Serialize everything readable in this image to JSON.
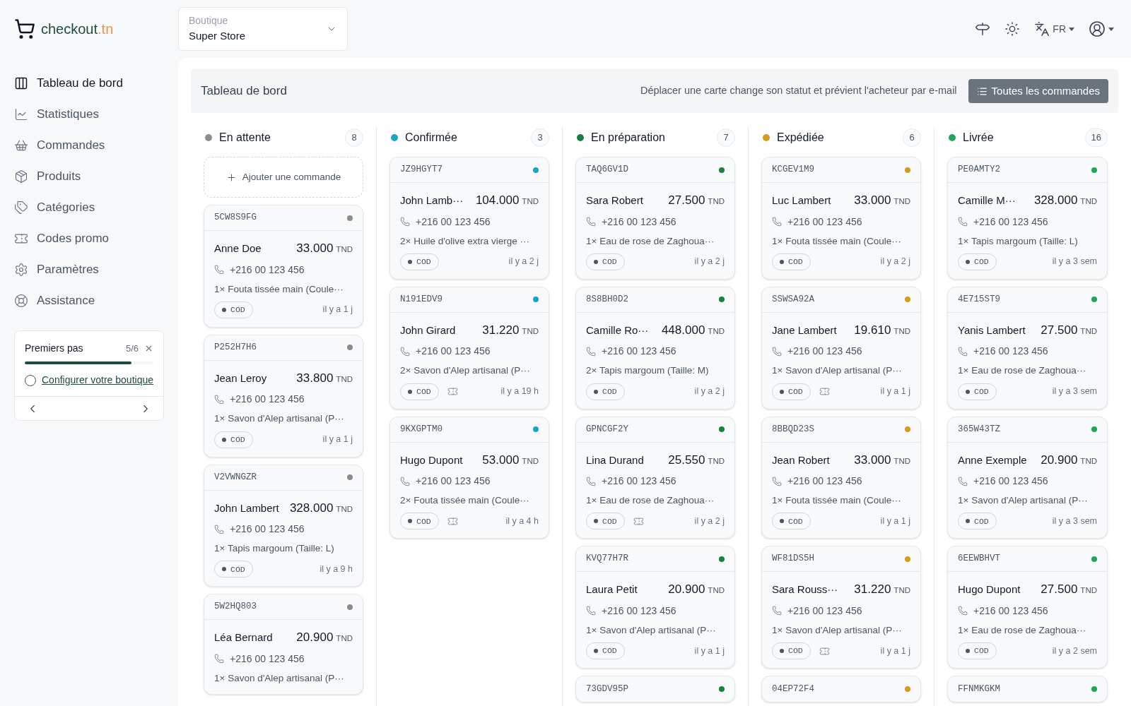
{
  "brand": {
    "name": "checkout",
    "suffix": ".tn"
  },
  "store_selector": {
    "label": "Boutique",
    "value": "Super Store"
  },
  "header": {
    "language": "FR"
  },
  "sidebar": {
    "items": [
      {
        "label": "Tableau de bord",
        "selected": true
      },
      {
        "label": "Statistiques",
        "selected": false
      },
      {
        "label": "Commandes",
        "selected": false
      },
      {
        "label": "Produits",
        "selected": false
      },
      {
        "label": "Catégories",
        "selected": false
      },
      {
        "label": "Codes promo",
        "selected": false
      },
      {
        "label": "Paramètres",
        "selected": false
      },
      {
        "label": "Assistance",
        "selected": false
      }
    ]
  },
  "getting_started": {
    "title": "Premiers pas",
    "progress": "5/6",
    "level": 0.83,
    "task": {
      "label": "Configurer votre boutique",
      "checked": false
    }
  },
  "page": {
    "title": "Tableau de bord",
    "hint": "Déplacer une carte change son statut et prévient l'acheteur par e-mail",
    "button": "Toutes les commandes"
  },
  "columns": [
    {
      "title": "En attente",
      "count": "8",
      "color": "#8c8c8c",
      "add_button": "Ajouter une commande",
      "cards": [
        {
          "id": "5CW8S9FG",
          "name": "Anne Doe",
          "amount": "33.000",
          "currency": "TND",
          "phone": "+216 00 123 456",
          "items": "1× Fouta tissée main (Coule···",
          "payment": "COD",
          "coupon": false,
          "time": "il y a 1 j"
        },
        {
          "id": "P252H7H6",
          "name": "Jean Leroy",
          "amount": "33.800",
          "currency": "TND",
          "phone": "+216 00 123 456",
          "items": "1× Savon d'Alep artisanal (P···",
          "payment": "COD",
          "coupon": false,
          "time": "il y a 1 j"
        },
        {
          "id": "V2VWNGZR",
          "name": "John Lambert",
          "amount": "328.000",
          "currency": "TND",
          "phone": "+216 00 123 456",
          "items": "1× Tapis margoum (Taille: L)",
          "payment": "COD",
          "coupon": false,
          "time": "il y a 9 h"
        },
        {
          "id": "5W2HQ803",
          "name": "Léa Bernard",
          "amount": "20.900",
          "currency": "TND",
          "phone": "+216 00 123 456",
          "items": "1× Savon d'Alep artisanal (P···"
        }
      ]
    },
    {
      "title": "Confirmée",
      "count": "3",
      "color": "#1ba3c6",
      "cards": [
        {
          "id": "JZ9HGYT7",
          "name": "John Lamb···",
          "amount": "104.000",
          "currency": "TND",
          "phone": "+216 00 123 456",
          "items": "2× Huile d'olive extra vierge ···",
          "payment": "COD",
          "coupon": false,
          "time": "il y a 2 j"
        },
        {
          "id": "N191EDV9",
          "name": "John Girard",
          "amount": "31.220",
          "currency": "TND",
          "phone": "+216 00 123 456",
          "items": "2× Savon d'Alep artisanal (P···",
          "payment": "COD",
          "coupon": true,
          "time": "il y a 19 h"
        },
        {
          "id": "9KXGPTM0",
          "name": "Hugo Dupont",
          "amount": "53.000",
          "currency": "TND",
          "phone": "+216 00 123 456",
          "items": "2× Fouta tissée main (Coule···",
          "payment": "COD",
          "coupon": true,
          "time": "il y a 4 h"
        }
      ]
    },
    {
      "title": "En préparation",
      "count": "7",
      "color": "#17803d",
      "cards": [
        {
          "id": "TAQ6GV1D",
          "name": "Sara Robert",
          "amount": "27.500",
          "currency": "TND",
          "phone": "+216 00 123 456",
          "items": "1× Eau de rose de Zaghoua···",
          "payment": "COD",
          "coupon": false,
          "time": "il y a 2 j"
        },
        {
          "id": "8S8BH0D2",
          "name": "Camille Ro···",
          "amount": "448.000",
          "currency": "TND",
          "phone": "+216 00 123 456",
          "items": "2× Tapis margoum (Taille: M)",
          "payment": "COD",
          "coupon": false,
          "time": "il y a 2 j"
        },
        {
          "id": "GPNCGF2Y",
          "name": "Lina Durand",
          "amount": "25.550",
          "currency": "TND",
          "phone": "+216 00 123 456",
          "items": "1× Eau de rose de Zaghoua···",
          "payment": "COD",
          "coupon": true,
          "time": "il y a 2 j"
        },
        {
          "id": "KVQ77H7R",
          "name": "Laura Petit",
          "amount": "20.900",
          "currency": "TND",
          "phone": "+216 00 123 456",
          "items": "1× Savon d'Alep artisanal (P···",
          "payment": "COD",
          "coupon": false,
          "time": "il y a 1 j"
        },
        {
          "id": "73GDV95P"
        }
      ]
    },
    {
      "title": "Expédiée",
      "count": "6",
      "color": "#d49a1c",
      "cards": [
        {
          "id": "KCGEV1M9",
          "name": "Luc Lambert",
          "amount": "33.000",
          "currency": "TND",
          "phone": "+216 00 123 456",
          "items": "1× Fouta tissée main (Coule···",
          "payment": "COD",
          "coupon": false,
          "time": "il y a 2 j"
        },
        {
          "id": "SSWSA92A",
          "name": "Jane Lambert",
          "amount": "19.610",
          "currency": "TND",
          "phone": "+216 00 123 456",
          "items": "1× Savon d'Alep artisanal (P···",
          "payment": "COD",
          "coupon": true,
          "time": "il y a 1 j"
        },
        {
          "id": "8BBQD23S",
          "name": "Jean Robert",
          "amount": "33.000",
          "currency": "TND",
          "phone": "+216 00 123 456",
          "items": "1× Fouta tissée main (Coule···",
          "payment": "COD",
          "coupon": false,
          "time": "il y a 1 j"
        },
        {
          "id": "WF81DS5H",
          "name": "Sara Rouss···",
          "amount": "31.220",
          "currency": "TND",
          "phone": "+216 00 123 456",
          "items": "1× Savon d'Alep artisanal (P···",
          "payment": "COD",
          "coupon": true,
          "time": "il y a 1 j"
        },
        {
          "id": "04EP72F4"
        }
      ]
    },
    {
      "title": "Livrée",
      "count": "16",
      "color": "#22a55a",
      "cards": [
        {
          "id": "PE0AMTY2",
          "name": "Camille M···",
          "amount": "328.000",
          "currency": "TND",
          "phone": "+216 00 123 456",
          "items": "1× Tapis margoum (Taille: L)",
          "payment": "COD",
          "coupon": false,
          "time": "il y a 3 sem"
        },
        {
          "id": "4E715ST9",
          "name": "Yanis Lambert",
          "amount": "27.500",
          "currency": "TND",
          "phone": "+216 00 123 456",
          "items": "1× Eau de rose de Zaghoua···",
          "payment": "COD",
          "coupon": false,
          "time": "il y a 3 sem"
        },
        {
          "id": "365W43TZ",
          "name": "Anne Exemple",
          "amount": "20.900",
          "currency": "TND",
          "phone": "+216 00 123 456",
          "items": "1× Savon d'Alep artisanal (P···",
          "payment": "COD",
          "coupon": false,
          "time": "il y a 3 sem"
        },
        {
          "id": "6EEWBHVT",
          "name": "Hugo Dupont",
          "amount": "27.500",
          "currency": "TND",
          "phone": "+216 00 123 456",
          "items": "1× Eau de rose de Zaghoua···",
          "payment": "COD",
          "coupon": false,
          "time": "il y a 2 sem"
        },
        {
          "id": "FFNMKGKM"
        }
      ]
    }
  ]
}
